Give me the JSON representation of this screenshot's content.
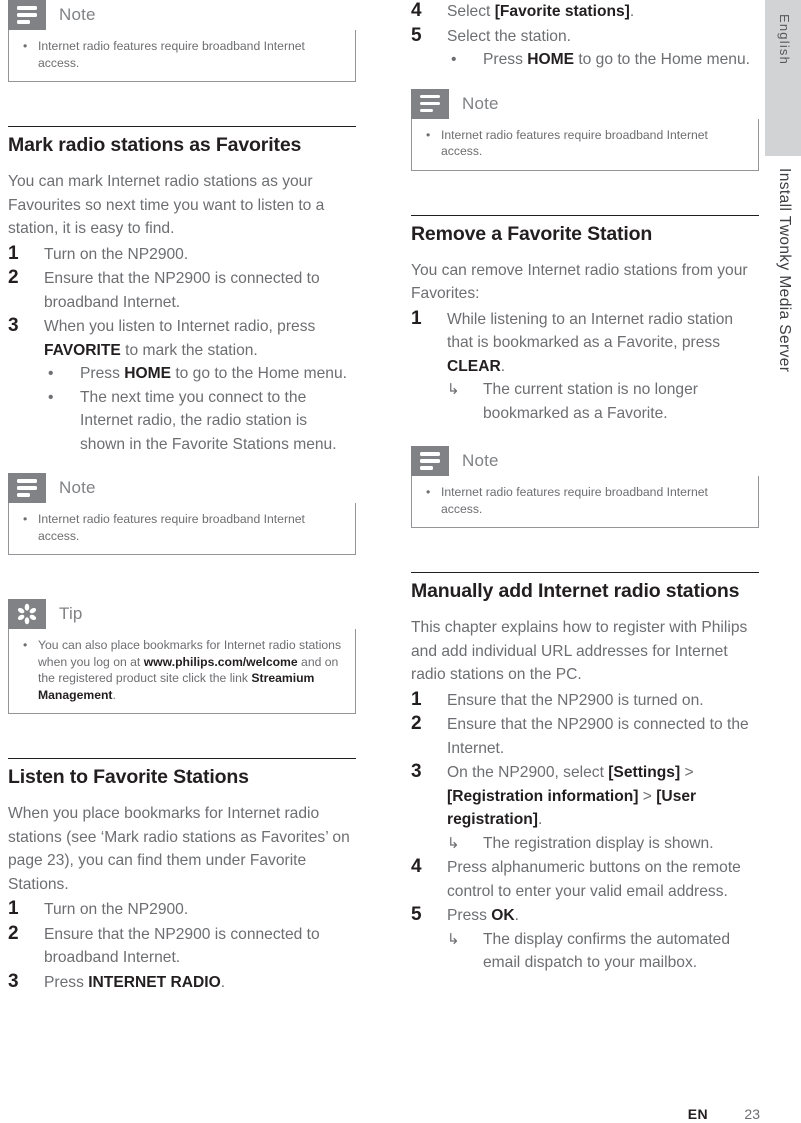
{
  "page": {
    "footer_language": "EN",
    "footer_page_number": "23",
    "side_tab_label": "English",
    "side_chapter_label": "Install Twonky Media Server",
    "colors": {
      "callout_icon_bg": "#808285",
      "side_tab_bg": "#d2d3d5",
      "heading": "#231f20",
      "body": "#6d6e71"
    }
  },
  "notes": {
    "note_title": "Note",
    "tip_title": "Tip",
    "internet_access_note": "Internet radio features require broadband Internet access.",
    "tip_bookmarks": {
      "part1": "You can also place bookmarks for Internet radio stations when you log on at ",
      "bold1": "www.philips.com/welcome",
      "part2": " and on the registered product site click the link ",
      "bold2": "Streamium Management",
      "part3": "."
    }
  },
  "left_column": {
    "top_note": {
      "icon": "note-lines-icon",
      "title": "Note",
      "text": "Internet radio features require broadband Internet access."
    },
    "section_mark": {
      "title": "Mark radio stations as Favorites",
      "intro": "You can mark Internet radio stations as your Favourites so next time you want to listen to a station, it is easy to find.",
      "steps": [
        {
          "num": "1",
          "text": "Turn on the NP2900.",
          "substeps": []
        },
        {
          "num": "2",
          "text": "Ensure that the NP2900 is connected to broadband Internet.",
          "substeps": []
        },
        {
          "num": "3",
          "text_a": "When you listen to Internet radio, press ",
          "text_b": "FAVORITE",
          "text_c": " to mark the station.",
          "substeps": [
            {
              "marker": "•",
              "a": "Press ",
              "b": "HOME",
              "c": " to go to the Home menu."
            },
            {
              "marker": "•",
              "a": "The next time you connect to the Internet radio, the radio station is shown in the Favorite Stations menu.",
              "b": "",
              "c": ""
            }
          ]
        }
      ]
    },
    "mid_note": {
      "icon": "note-lines-icon",
      "title": "Note",
      "text": "Internet radio features require broadband Internet access."
    },
    "tip": {
      "icon": "asterisk-icon",
      "title": "Tip"
    },
    "section_listen": {
      "title": "Listen to Favorite Stations",
      "intro": "When you place bookmarks for Internet radio stations (see ‘Mark radio stations as Favorites’ on page 23), you can find them under Favorite Stations.",
      "steps": [
        {
          "num": "1",
          "text": "Turn on the NP2900."
        },
        {
          "num": "2",
          "text": "Ensure that the NP2900 is connected to broadband Internet."
        },
        {
          "num": "3",
          "text_a": "Press ",
          "text_b": "INTERNET RADIO",
          "text_c": "."
        }
      ]
    }
  },
  "right_column": {
    "steps_continued": [
      {
        "num": "4",
        "text_a": "Select ",
        "text_b": "[Favorite stations]",
        "text_c": "."
      },
      {
        "num": "5",
        "text_a": "Select the station.",
        "text_b": "",
        "text_c": "",
        "substeps": [
          {
            "marker": "•",
            "a": "Press ",
            "b": "HOME",
            "c": " to go to the Home menu."
          }
        ]
      }
    ],
    "note_top": {
      "icon": "note-lines-icon",
      "title": "Note",
      "text": "Internet radio features require broadband Internet access."
    },
    "section_remove": {
      "title": "Remove a Favorite Station",
      "intro": "You can remove Internet radio stations from your Favorites:",
      "steps": [
        {
          "num": "1",
          "text_a": "While listening to an Internet radio station that is bookmarked as a Favorite, press ",
          "text_b": "CLEAR",
          "text_c": ".",
          "substeps": [
            {
              "marker": "↳",
              "a": "The current station is no longer bookmarked as a Favorite.",
              "b": "",
              "c": ""
            }
          ]
        }
      ]
    },
    "note_bottom": {
      "icon": "note-lines-icon",
      "title": "Note",
      "text": "Internet radio features require broadband Internet access."
    },
    "section_manual": {
      "title": "Manually add Internet radio stations",
      "intro": "This chapter explains how to register with Philips and add individual URL addresses for Internet radio stations on the PC.",
      "steps": [
        {
          "num": "1",
          "text": "Ensure that the NP2900 is turned on."
        },
        {
          "num": "2",
          "text": "Ensure that the NP2900 is connected to the Internet."
        },
        {
          "num": "3",
          "text_a": "On the NP2900, select ",
          "text_b": "[Settings]",
          "text_c": " > ",
          "text_d": "[Registration information]",
          "text_e": " > ",
          "text_f": "[User registration]",
          "text_g": ".",
          "substeps": [
            {
              "marker": "↳",
              "a": "The registration display is shown."
            }
          ]
        },
        {
          "num": "4",
          "text": "Press alphanumeric buttons on the remote control to enter your valid email address."
        },
        {
          "num": "5",
          "text_a": "Press ",
          "text_b": "OK",
          "text_c": ".",
          "substeps": [
            {
              "marker": "↳",
              "a": "The display confirms the automated email dispatch to your mailbox."
            }
          ]
        }
      ]
    }
  }
}
